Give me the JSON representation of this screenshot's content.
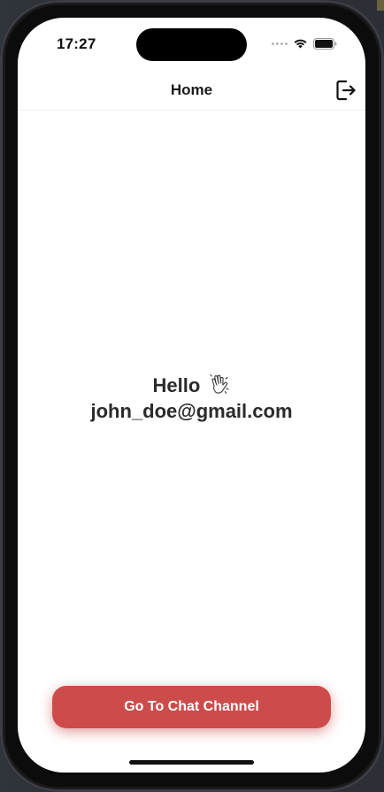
{
  "status_bar": {
    "time": "17:27"
  },
  "nav": {
    "title": "Home",
    "logout_icon": "logout-icon"
  },
  "greeting": {
    "hello": "Hello",
    "wave_icon": "waving-hand-icon",
    "email": "john_doe@gmail.com"
  },
  "actions": {
    "chat_button_label": "Go To Chat Channel"
  },
  "colors": {
    "accent": "#cc4c4c",
    "text": "#2b2b2b",
    "background": "#ffffff"
  }
}
